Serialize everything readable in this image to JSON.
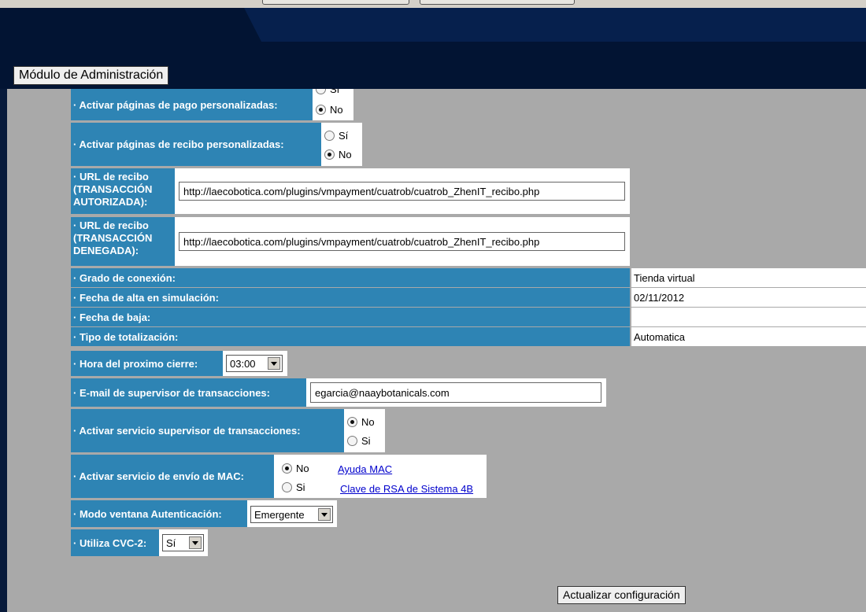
{
  "header": {
    "module_button": "Módulo de Administración"
  },
  "form": {
    "pay_pages": {
      "label": "· Activar páginas de pago personalizadas:",
      "opt_yes": "Sí",
      "opt_no": "No",
      "selected": "No"
    },
    "receipt_pages": {
      "label": "· Activar páginas de recibo personalizadas:",
      "opt_yes": "Sí",
      "opt_no": "No",
      "selected": "No"
    },
    "url_ok": {
      "label": "· URL de recibo (TRANSACCIÓN AUTORIZADA):",
      "value": "http://laecobotica.com/plugins/vmpayment/cuatrob/cuatrob_ZhenIT_recibo.php"
    },
    "url_denied": {
      "label": "· URL de recibo (TRANSACCIÓN DENEGADA):",
      "value": "http://laecobotica.com/plugins/vmpayment/cuatrob/cuatrob_ZhenIT_recibo.php"
    },
    "info_rows": [
      {
        "label": "· Grado de conexión:",
        "value": "Tienda virtual"
      },
      {
        "label": "· Fecha de alta en simulación:",
        "value": "02/11/2012"
      },
      {
        "label": "· Fecha de baja:",
        "value": ""
      },
      {
        "label": "· Tipo de totalización:",
        "value": "Automatica"
      }
    ],
    "close_time": {
      "label": "· Hora del proximo cierre:",
      "value": "03:00"
    },
    "supervisor_email": {
      "label": "· E-mail de supervisor de transacciones:",
      "value": "egarcia@naaybotanicals.com"
    },
    "supervisor_service": {
      "label": "· Activar servicio supervisor de transacciones:",
      "opt_no": "No",
      "opt_yes": "Si",
      "selected": "No"
    },
    "mac_service": {
      "label": "· Activar servicio de envío de MAC:",
      "opt_no": "No",
      "opt_yes": "Si",
      "selected": "No",
      "help_link": "Ayuda MAC",
      "rsa_link": "Clave de RSA de Sistema 4B"
    },
    "auth_window": {
      "label": "· Modo ventana Autenticación:",
      "value": "Emergente"
    },
    "cvc2": {
      "label": "· Utiliza CVC-2:",
      "value": "Sí"
    }
  },
  "footer": {
    "update_button": "Actualizar configuración"
  }
}
